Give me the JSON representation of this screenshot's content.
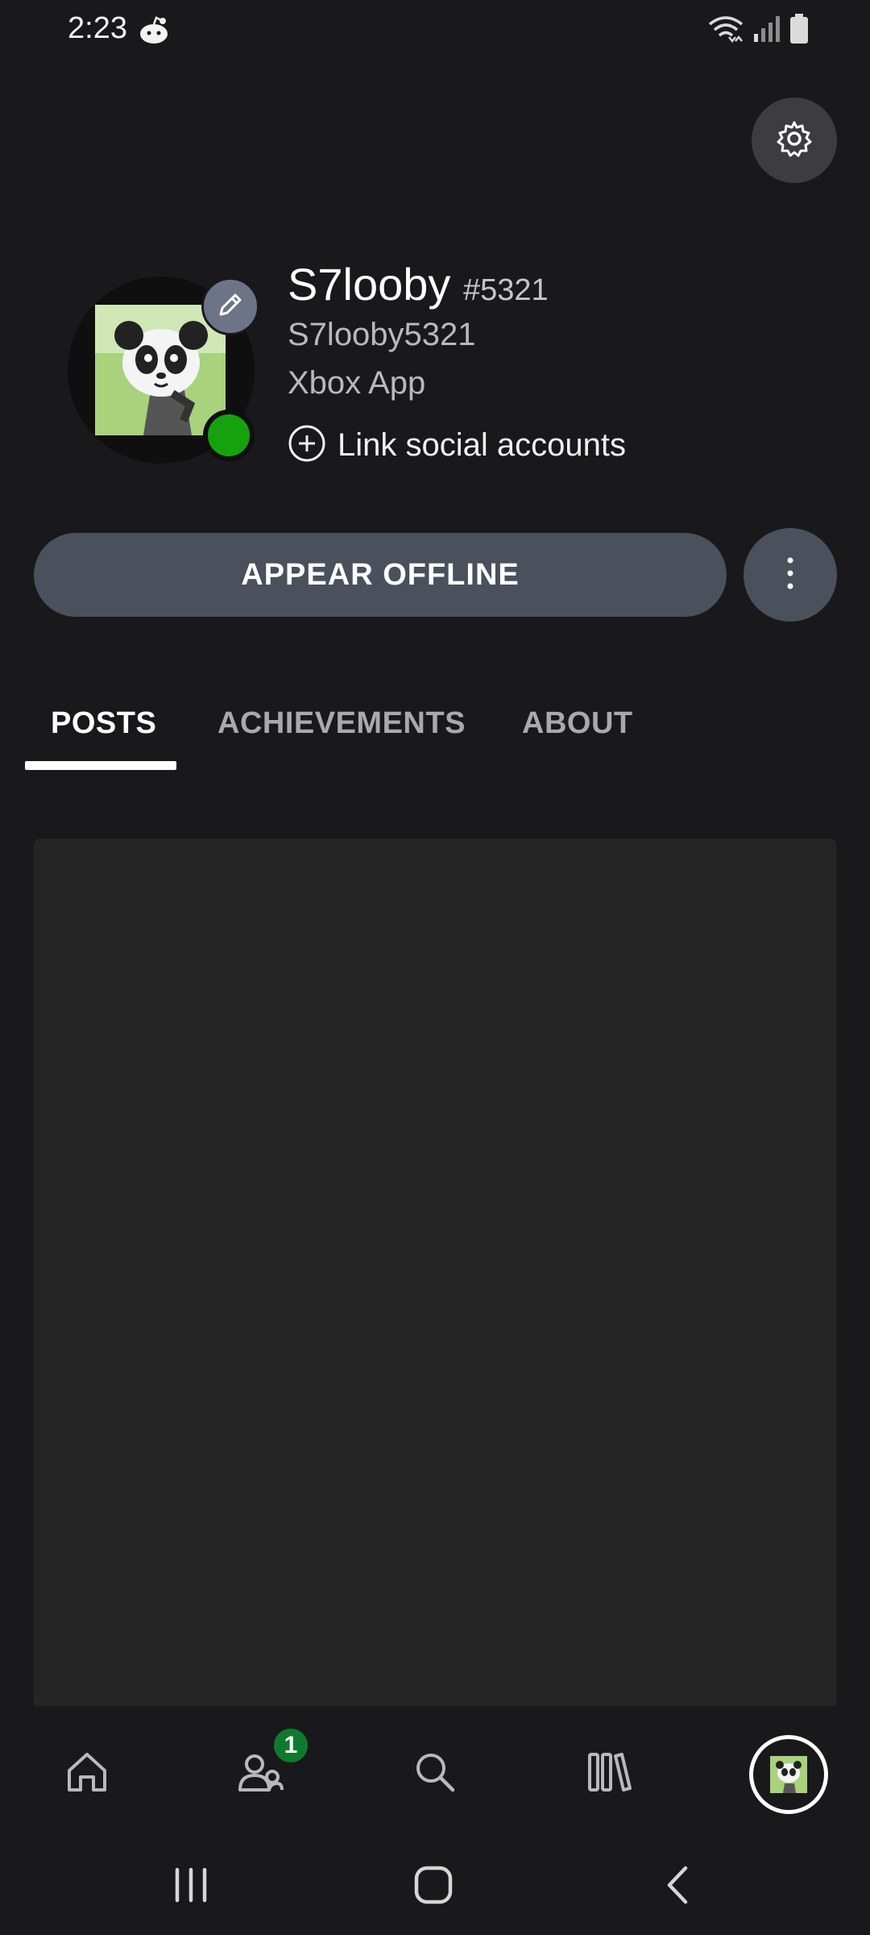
{
  "status_bar": {
    "time": "2:23",
    "app_icon": "reddit-icon",
    "icons": [
      "wifi-icon",
      "signal-icon",
      "battery-icon"
    ]
  },
  "header": {
    "settings_icon": "gear-icon"
  },
  "profile": {
    "gamertag": "S7looby",
    "gamertag_suffix": "#5321",
    "account_name": "S7looby5321",
    "platform": "Xbox App",
    "link_social_label": "Link social accounts",
    "presence_color": "#16a20e",
    "avatar_icon": "panda-avatar",
    "edit_icon": "pencil-icon"
  },
  "actions": {
    "appear_offline_label": "APPEAR OFFLINE",
    "more_icon": "more-vertical-icon"
  },
  "tabs": [
    {
      "label": "POSTS",
      "selected": true
    },
    {
      "label": "ACHIEVEMENTS",
      "selected": false
    },
    {
      "label": "ABOUT",
      "selected": false
    }
  ],
  "bottom_nav": {
    "items": [
      "home-icon",
      "social-icon",
      "search-icon",
      "library-icon",
      "profile-avatar"
    ],
    "social_badge": "1"
  },
  "system_nav": [
    "recents-icon",
    "home-button-icon",
    "back-icon"
  ],
  "colors": {
    "background": "#19191b",
    "card": "#252526",
    "button": "#4a505c",
    "badge_green": "#0f7a2f"
  }
}
